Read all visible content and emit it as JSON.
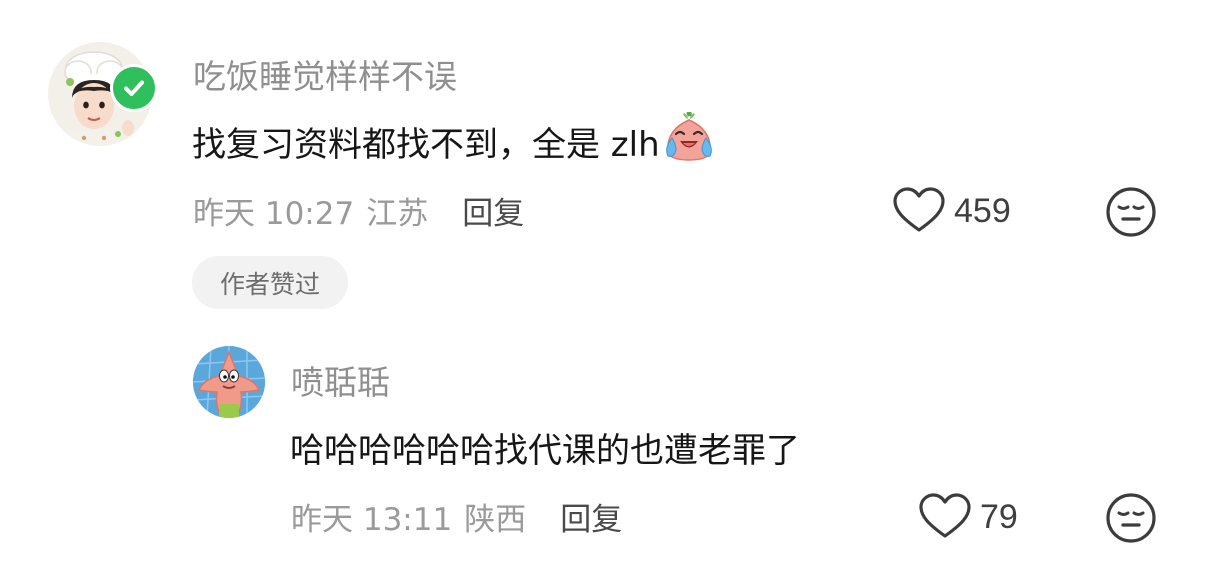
{
  "comments": [
    {
      "username": "吃饭睡觉样样不误",
      "text": "找复习资料都找不到，全是 zlh",
      "emoji": "crying-laughing-sticker-icon",
      "time": "昨天 10:27",
      "location": "江苏",
      "reply_label": "回复",
      "likes": "459",
      "author_liked_badge": "作者赞过",
      "verified": true
    },
    {
      "username": "喷聒聒",
      "text": "哈哈哈哈哈哈找代课的也遭老罪了",
      "time": "昨天 13:11",
      "location": "陕西",
      "reply_label": "回复",
      "likes": "79"
    }
  ],
  "colors": {
    "username": "#8f8f8f",
    "text": "#161616",
    "meta": "#9a9a9a",
    "verified_green": "#2fbf5c",
    "badge_bg": "#f2f2f2"
  }
}
